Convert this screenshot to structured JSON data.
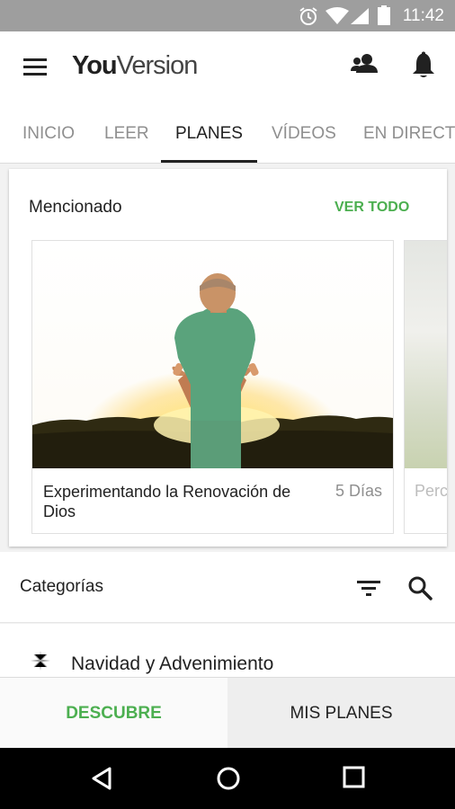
{
  "status_bar": {
    "time": "11:42",
    "icons": [
      "alarm-icon",
      "wifi-icon",
      "signal-icon",
      "battery-icon"
    ]
  },
  "app_bar": {
    "logo_you": "You",
    "logo_version": "Version",
    "icons": [
      "menu-icon",
      "people-icon",
      "bell-icon"
    ]
  },
  "tabs": [
    {
      "label": "INICIO",
      "active": false
    },
    {
      "label": "LEER",
      "active": false
    },
    {
      "label": "PLANES",
      "active": true
    },
    {
      "label": "VÍDEOS",
      "active": false
    },
    {
      "label": "EN DIRECTO",
      "active": false
    }
  ],
  "featured": {
    "title": "Mencionado",
    "see_all": "VER TODO",
    "plans": [
      {
        "title": "Experimentando la Renovación de Dios",
        "days": "5 Días"
      },
      {
        "title": "Perc",
        "days": ""
      }
    ]
  },
  "categories": {
    "title": "Categorías",
    "items": [
      {
        "label": "Navidad y Advenimiento",
        "icon": "star-icon"
      }
    ]
  },
  "bottom_tabs": {
    "discover": "DESCUBRE",
    "my_plans": "MIS PLANES",
    "active": "discover"
  },
  "colors": {
    "accent_green": "#4caf50",
    "status_bar": "#9e9e9e",
    "nav_bar": "#000000"
  }
}
